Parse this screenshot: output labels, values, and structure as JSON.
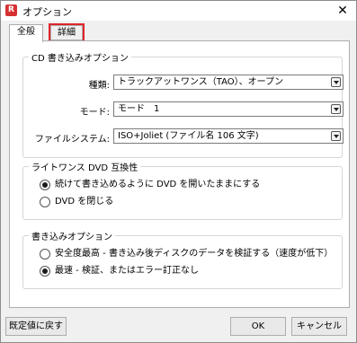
{
  "window": {
    "title": "オプション",
    "icon": "app-logo-icon",
    "close": "✕"
  },
  "tabs": [
    {
      "label": "全般"
    },
    {
      "label": "詳細"
    }
  ],
  "cd_options": {
    "title": "CD 書き込みオプション",
    "type_label": "種類:",
    "type_value": "トラックアットワンス（TAO）、オープン",
    "mode_label": "モード:",
    "mode_value": "モード　1",
    "filesystem_label": "ファイルシステム:",
    "filesystem_value": "ISO+Joliet (ファイル名 106 文字)"
  },
  "dvd_compat": {
    "title": "ライトワンス DVD 互換性",
    "option1": "続けて書き込めるように DVD を開いたままにする",
    "option2": "DVD を閉じる"
  },
  "write_options": {
    "title": "書き込みオプション",
    "option1": "安全度最高 - 書き込み後ディスクのデータを検証する（速度が低下）",
    "option2": "最速 - 検証、またはエラー訂正なし"
  },
  "buttons": {
    "defaults": "既定値に戻す",
    "ok": "OK",
    "cancel": "キャンセル"
  },
  "colors": {
    "highlight": "#e0242b",
    "accent": "#d63131"
  }
}
